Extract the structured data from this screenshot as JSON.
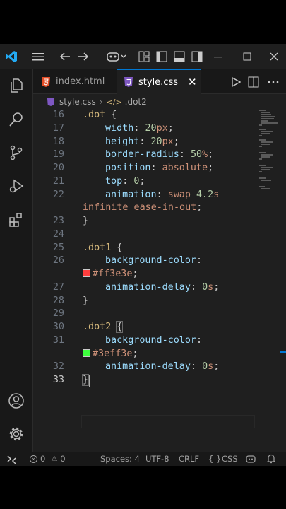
{
  "tabs": [
    {
      "label": "index.html",
      "icon": "html5-file-icon",
      "active": false
    },
    {
      "label": "style.css",
      "icon": "css-file-icon",
      "active": true
    }
  ],
  "breadcrumb": {
    "file": "style.css",
    "symbol": ".dot2"
  },
  "editor": {
    "line_numbers": [
      "16",
      "17",
      "18",
      "19",
      "20",
      "21",
      "22",
      "",
      "23",
      "24",
      "25",
      "26",
      "",
      "27",
      "28",
      "29",
      "30",
      "31",
      "",
      "32",
      "33"
    ],
    "current_line": "33",
    "tokens": {
      "l16_sel": ".dot",
      "l16_brace": " {",
      "l17_prop": "width",
      "l17_colon": ": ",
      "l17_num": "20",
      "l17_unit": "px",
      "l17_semi": ";",
      "l18_prop": "height",
      "l18_colon": ": ",
      "l18_num": "20",
      "l18_unit": "px",
      "l18_semi": ";",
      "l19_prop": "border-radius",
      "l19_colon": ": ",
      "l19_num": "50",
      "l19_unit": "%",
      "l19_semi": ";",
      "l20_prop": "position",
      "l20_colon": ": ",
      "l20_val": "absolute",
      "l20_semi": ";",
      "l21_prop": "top",
      "l21_colon": ": ",
      "l21_num": "0",
      "l21_semi": ";",
      "l22_prop": "animation",
      "l22_colon": ": ",
      "l22_val": "swap ",
      "l22_num": "4.2",
      "l22_unit": "s",
      "l22w_val": "infinite ease-in-out",
      "l22w_semi": ";",
      "l23_brace": "}",
      "l25_sel": ".dot1",
      "l25_brace": " {",
      "l26_prop": "background-color",
      "l26_colon": ":",
      "l26w_val": "#ff3e3e",
      "l26w_semi": ";",
      "l27_prop": "animation-delay",
      "l27_colon": ": ",
      "l27_num": "0",
      "l27_unit": "s",
      "l27_semi": ";",
      "l28_brace": "}",
      "l30_sel": ".dot2",
      "l30_brace": "{",
      "l31_prop": "background-color",
      "l31_colon": ":",
      "l31w_val": "#3eff3e",
      "l31w_semi": ";",
      "l32_prop": "animation-delay",
      "l32_colon": ": ",
      "l32_num": "0",
      "l32_unit": "s",
      "l32_semi": ";",
      "l33_brace": "}"
    },
    "swatch_colors": {
      "dot1": "#ff3e3e",
      "dot2": "#3eff3e"
    }
  },
  "statusbar": {
    "errors": "0",
    "warnings": "0",
    "spaces": "Spaces: 4",
    "encoding": "UTF-8",
    "eol": "CRLF",
    "language": "CSS"
  },
  "colors": {
    "accent": "#0078d4",
    "selector": "#d7ba7d",
    "property": "#9cdcfe",
    "number": "#b5cea8",
    "string_value": "#ce9178",
    "vscode_logo": "#23a9f2"
  }
}
